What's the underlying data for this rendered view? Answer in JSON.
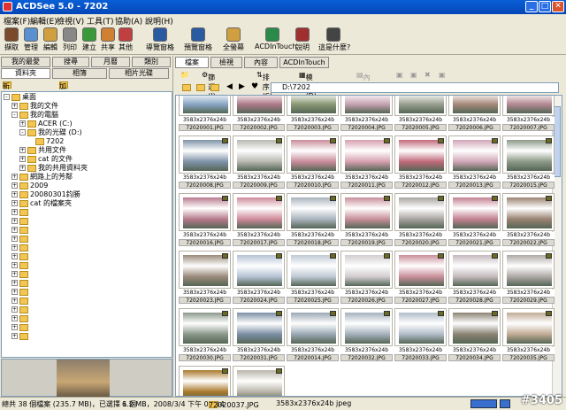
{
  "window": {
    "title": "ACDSee 5.0 - 7202"
  },
  "menu": [
    "檔案(F)",
    "編輯(E)",
    "檢視(V)",
    "工具(T)",
    "協助(A)",
    "說明(H)"
  ],
  "toolbar": [
    {
      "label": "擷取",
      "icon": "capture-icon",
      "color": "#7a4a2a"
    },
    {
      "label": "管理",
      "icon": "manage-icon",
      "color": "#5a8fd0"
    },
    {
      "label": "編輯",
      "icon": "edit-icon",
      "color": "#d0a040"
    },
    {
      "label": "列印",
      "icon": "print-icon",
      "color": "#888888"
    },
    {
      "label": "建立",
      "icon": "create-icon",
      "color": "#3a9a3a"
    },
    {
      "label": "共享",
      "icon": "share-icon",
      "color": "#d08030"
    },
    {
      "label": "其他",
      "icon": "other-icon",
      "color": "#c04040"
    },
    {
      "label": "導覽窗格",
      "icon": "nav-pane-icon",
      "color": "#2a5aa0"
    },
    {
      "label": "預覽窗格",
      "icon": "preview-pane-icon",
      "color": "#2a5aa0"
    },
    {
      "label": "全螢幕",
      "icon": "fullscreen-icon",
      "color": "#d0a040"
    },
    {
      "label": "ACDInTouch",
      "icon": "acdintouch-icon",
      "color": "#2a8a4a"
    },
    {
      "label": "說明",
      "icon": "help-book-icon",
      "color": "#a03030"
    },
    {
      "label": "這是什麼?",
      "icon": "whats-this-icon",
      "color": "#444444"
    }
  ],
  "left_tabs_top": [
    "我的最愛",
    "搜尋",
    "月曆",
    "類別"
  ],
  "left_tabs_bottom": [
    "資料夾",
    "相簿",
    "相片光碟"
  ],
  "fav_row": {
    "new_folder": "新增資料夾",
    "add_fav": "加入我的最愛"
  },
  "tree": [
    {
      "label": "桌面",
      "depth": 0,
      "pm": "-"
    },
    {
      "label": "我的文件",
      "depth": 1,
      "pm": "+"
    },
    {
      "label": "我的電腦",
      "depth": 1,
      "pm": "-"
    },
    {
      "label": "ACER (C:)",
      "depth": 2,
      "pm": "+"
    },
    {
      "label": "我的光碟 (D:)",
      "depth": 2,
      "pm": "-"
    },
    {
      "label": "7202",
      "depth": 3,
      "pm": ""
    },
    {
      "label": "共用文件",
      "depth": 2,
      "pm": "+"
    },
    {
      "label": "cat 的文件",
      "depth": 2,
      "pm": "+"
    },
    {
      "label": "我的共用資料夾",
      "depth": 2,
      "pm": "+"
    },
    {
      "label": "網路上的芳鄰",
      "depth": 1,
      "pm": "+"
    },
    {
      "label": "2009",
      "depth": 1,
      "pm": "+"
    },
    {
      "label": "20080301鈞勝",
      "depth": 1,
      "pm": "+"
    },
    {
      "label": "cat 的檔案夾",
      "depth": 1,
      "pm": "+"
    },
    {
      "label": "",
      "depth": 1,
      "pm": "+"
    },
    {
      "label": "",
      "depth": 1,
      "pm": "+"
    },
    {
      "label": "",
      "depth": 1,
      "pm": "+"
    },
    {
      "label": "",
      "depth": 1,
      "pm": "+"
    },
    {
      "label": "",
      "depth": 1,
      "pm": "+"
    },
    {
      "label": "",
      "depth": 1,
      "pm": "+"
    },
    {
      "label": "",
      "depth": 1,
      "pm": "+"
    },
    {
      "label": "",
      "depth": 1,
      "pm": "+"
    },
    {
      "label": "",
      "depth": 1,
      "pm": "+"
    },
    {
      "label": "",
      "depth": 1,
      "pm": "+"
    },
    {
      "label": "",
      "depth": 1,
      "pm": "+"
    },
    {
      "label": "",
      "depth": 1,
      "pm": "+"
    },
    {
      "label": "",
      "depth": 1,
      "pm": "+"
    },
    {
      "label": "",
      "depth": 1,
      "pm": "+"
    },
    {
      "label": "",
      "depth": 1,
      "pm": "+"
    }
  ],
  "right_tabs": [
    "檔案",
    "檢視",
    "內容",
    "ACDInTouch"
  ],
  "right_toolbar": {
    "filter": "篩選(I)",
    "sort": "排序(S)",
    "mode": "模式(D)",
    "props": "內容"
  },
  "path": "D:\\7202",
  "dims_text": "3583x2376x24b",
  "files": [
    {
      "name": "72020001.JPG",
      "tone": "#8aa7c6"
    },
    {
      "name": "72020002.JPG",
      "tone": "#b07a8a"
    },
    {
      "name": "72020003.JPG",
      "tone": "#8c9a76"
    },
    {
      "name": "72020004.JPG",
      "tone": "#c7a3b2"
    },
    {
      "name": "72020005.JPG",
      "tone": "#9aa090"
    },
    {
      "name": "72020006.JPG",
      "tone": "#a88a7a"
    },
    {
      "name": "72020007.JPG",
      "tone": "#b58a94"
    },
    {
      "name": "72020008.JPG",
      "tone": "#7f93a8"
    },
    {
      "name": "72020009.JPG",
      "tone": "#b8b8b0"
    },
    {
      "name": "72020010.JPG",
      "tone": "#c98c9a"
    },
    {
      "name": "72020011.JPG",
      "tone": "#d6a0b0"
    },
    {
      "name": "72020012.JPG",
      "tone": "#c06a7a"
    },
    {
      "name": "72020013.JPG",
      "tone": "#d0a6b6"
    },
    {
      "name": "72020015.JPG",
      "tone": "#8c9a88"
    },
    {
      "name": "72020016.JPG",
      "tone": "#b77a8c"
    },
    {
      "name": "72020017.JPG",
      "tone": "#cf8a9a"
    },
    {
      "name": "72020018.JPG",
      "tone": "#a9b3bd"
    },
    {
      "name": "72020019.JPG",
      "tone": "#c78f99"
    },
    {
      "name": "72020020.JPG",
      "tone": "#a8a4a0"
    },
    {
      "name": "72020021.JPG",
      "tone": "#c28090"
    },
    {
      "name": "72020022.JPG",
      "tone": "#9a8272"
    },
    {
      "name": "72020023.JPG",
      "tone": "#9a8a7a"
    },
    {
      "name": "72020024.JPG",
      "tone": "#b4c2d4"
    },
    {
      "name": "72020025.JPG",
      "tone": "#bfc9d4"
    },
    {
      "name": "72020026.JPG",
      "tone": "#d2ccd0"
    },
    {
      "name": "72020027.JPG",
      "tone": "#c98e9a"
    },
    {
      "name": "72020028.JPG",
      "tone": "#c4b8bc"
    },
    {
      "name": "72020029.JPG",
      "tone": "#ada8a4"
    },
    {
      "name": "72020030.JPG",
      "tone": "#8a988a"
    },
    {
      "name": "72020031.JPG",
      "tone": "#7a8ea4"
    },
    {
      "name": "72020014.JPG",
      "tone": "#9aa8b4"
    },
    {
      "name": "72020032.JPG",
      "tone": "#a4b0bc"
    },
    {
      "name": "72020033.JPG",
      "tone": "#b0bcc8"
    },
    {
      "name": "72020034.JPG",
      "tone": "#8a8272"
    },
    {
      "name": "72020035.JPG",
      "tone": "#c0aa94"
    },
    {
      "name": "",
      "tone": "#a8782a"
    },
    {
      "name": "",
      "tone": "#b8b4a8"
    }
  ],
  "status": {
    "total": "總共 38 個檔案 (235.7 MB)，已選擇 1 個",
    "size": "6.2 MB，2008/3/4 下午 03:14",
    "file": "72020037.JPG",
    "dims": "3583x2376x24b jpeg"
  },
  "watermark": "#3405"
}
